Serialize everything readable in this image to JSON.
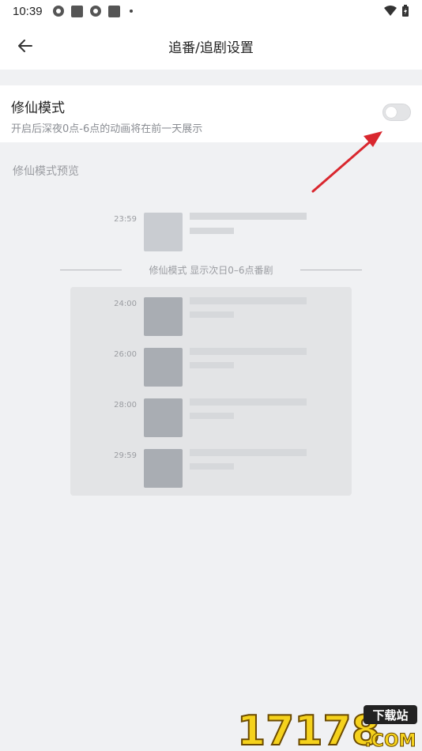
{
  "status_bar": {
    "time": "10:39"
  },
  "app_bar": {
    "title": "追番/追剧设置"
  },
  "setting": {
    "title": "修仙模式",
    "description": "开启后深夜0点-6点的动画将在前一天展示",
    "enabled": false
  },
  "preview": {
    "label": "修仙模式预览",
    "first_time": "23:59",
    "divider_text": "修仙模式 显示次日0–6点番剧",
    "times": [
      "24:00",
      "26:00",
      "28:00",
      "29:59"
    ]
  },
  "watermark": {
    "number": "17178",
    "badge": "下载站",
    "domain": ".COM"
  },
  "colors": {
    "accent_arrow": "#d9272e",
    "thumb_light": "#c9ccd1",
    "thumb_dark": "#a9adb3",
    "watermark_yellow": "#f5d21c"
  }
}
